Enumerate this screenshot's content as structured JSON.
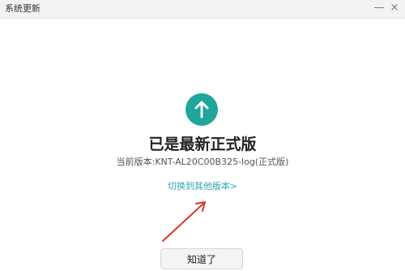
{
  "window": {
    "title": "系统更新",
    "minimize_glyph": "—",
    "close_glyph": "×"
  },
  "update": {
    "status_icon": "arrow-up-icon",
    "heading": "已是最新正式版",
    "current_version": "当前版本:KNT-AL20C00B325-log(正式版)",
    "switch_link": "切换到其他版本>",
    "ok_button": "知道了"
  },
  "colors": {
    "accent": "#2ca8b8",
    "icon_bg": "#1fa59a",
    "annotation_arrow": "#d9342b"
  }
}
